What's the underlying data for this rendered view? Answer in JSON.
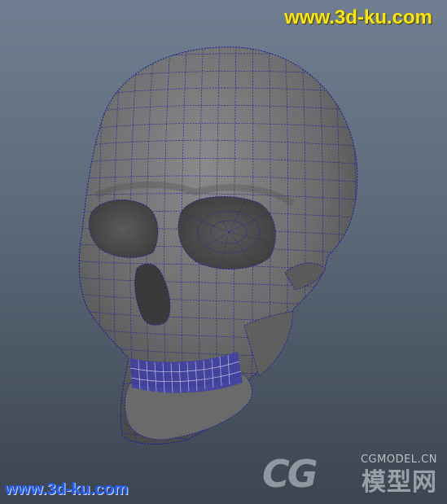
{
  "watermark_top": {
    "text": "www.3d-ku.com",
    "color": "#ffe600"
  },
  "watermark_bottom": {
    "text": "www.3d-ku.com",
    "color": "#1f5cff"
  },
  "logo": {
    "letters": "CG",
    "site": "CGMODEL.CN",
    "chinese": "模型网"
  },
  "viewport": {
    "subject": "skull-wireframe-icon",
    "wireframe_color": "#1a1aa0",
    "mesh_color": "#6e6e6e"
  }
}
